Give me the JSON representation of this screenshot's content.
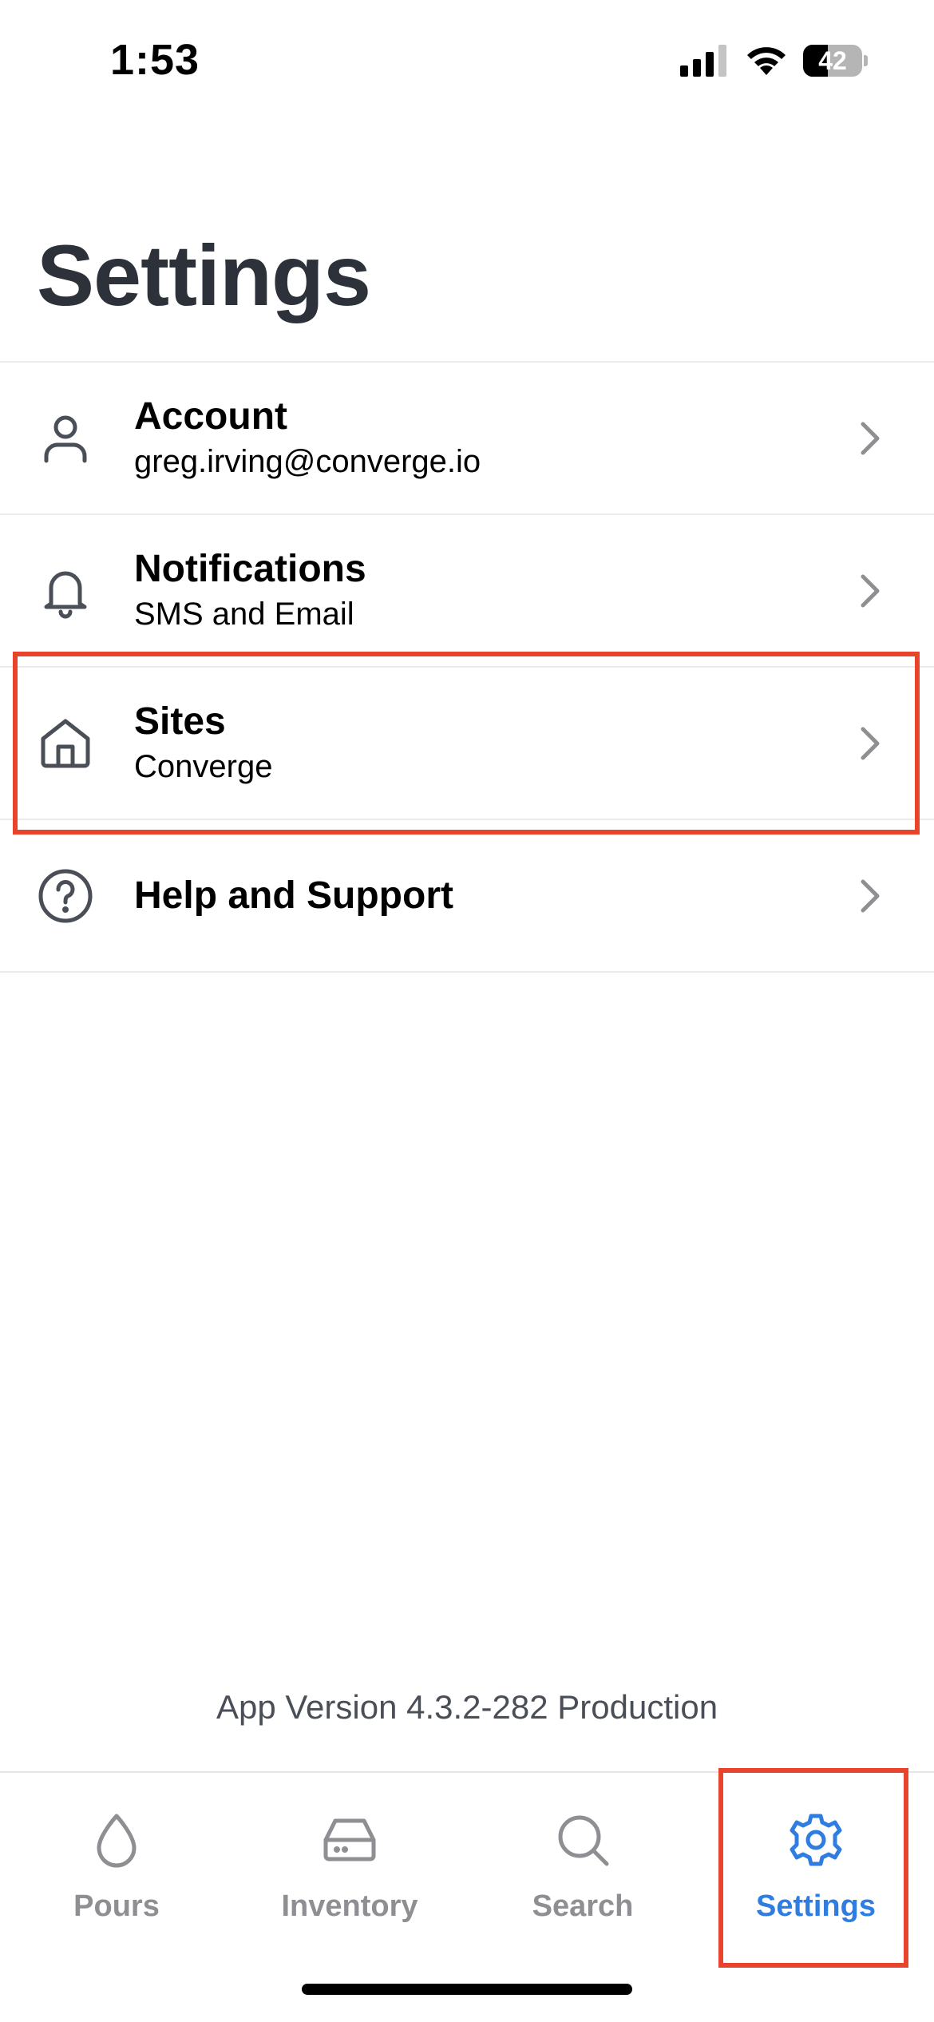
{
  "status_bar": {
    "time": "1:53",
    "battery": "42",
    "battery_level": 0.42
  },
  "page": {
    "title": "Settings"
  },
  "settings": {
    "items": [
      {
        "title": "Account",
        "subtitle": "greg.irving@converge.io",
        "icon": "person-icon"
      },
      {
        "title": "Notifications",
        "subtitle": "SMS and Email",
        "icon": "bell-icon"
      },
      {
        "title": "Sites",
        "subtitle": "Converge",
        "icon": "home-icon"
      },
      {
        "title": "Help and Support",
        "subtitle": "",
        "icon": "question-circle-icon"
      }
    ]
  },
  "footer": {
    "app_version": "App Version 4.3.2-282 Production"
  },
  "tab_bar": {
    "active": "Settings",
    "tabs": [
      {
        "label": "Pours",
        "icon": "drop-icon"
      },
      {
        "label": "Inventory",
        "icon": "hard-drive-icon"
      },
      {
        "label": "Search",
        "icon": "search-icon"
      },
      {
        "label": "Settings",
        "icon": "gear-icon"
      }
    ]
  },
  "colors": {
    "accent": "#2f7de1",
    "highlight": "#e8432d",
    "title": "#2c313a",
    "inactive_tab": "#8e8e93"
  }
}
